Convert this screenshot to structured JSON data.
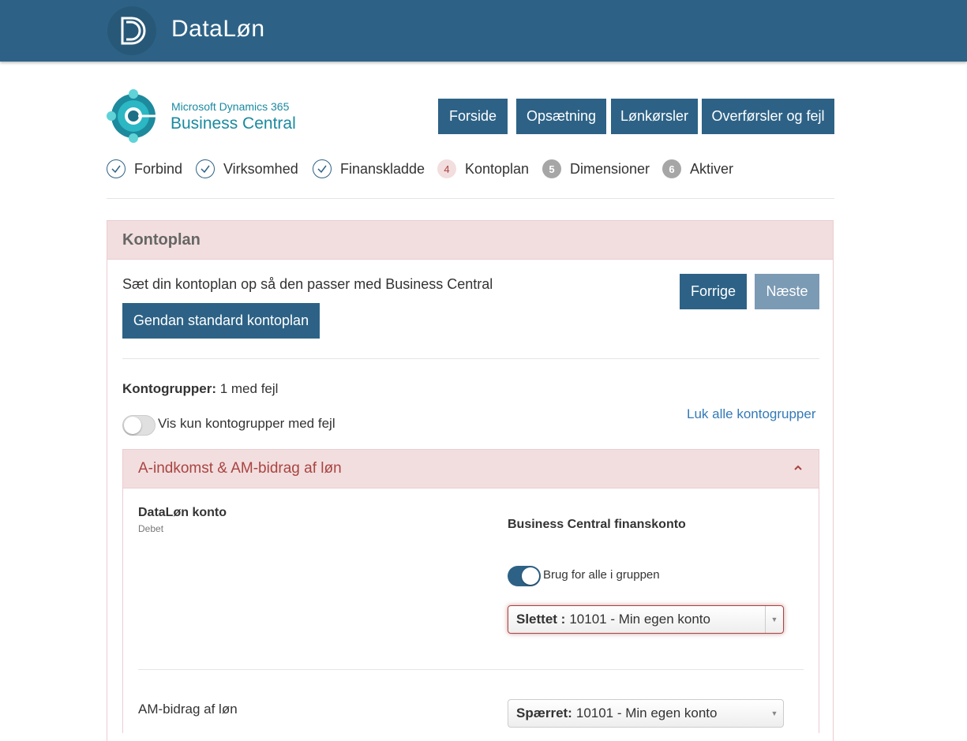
{
  "header": {
    "app_title": "DataLøn",
    "logo_icon": "dataloen-logo-icon"
  },
  "brand": {
    "line1": "Microsoft Dynamics 365",
    "line2": "Business Central",
    "logo_icon": "business-central-logo-icon"
  },
  "nav": {
    "forside": "Forside",
    "opsaetning": "Opsætning",
    "loenkoersler": "Lønkørsler",
    "overfoersler": "Overførsler og fejl"
  },
  "steps": [
    {
      "label": "Forbind",
      "state": "done"
    },
    {
      "label": "Virksomhed",
      "state": "done"
    },
    {
      "label": "Finanskladde",
      "state": "done"
    },
    {
      "num": "4",
      "label": "Kontoplan",
      "state": "active"
    },
    {
      "num": "5",
      "label": "Dimensioner",
      "state": "todo"
    },
    {
      "num": "6",
      "label": "Aktiver",
      "state": "todo"
    }
  ],
  "panel": {
    "title": "Kontoplan",
    "description": "Sæt din kontoplan op så den passer med Business Central",
    "restore_button": "Gendan standard kontoplan",
    "prev_button": "Forrige",
    "next_button": "Næste",
    "groups_label": "Kontogrupper:",
    "groups_value": "1 med fejl",
    "toggle_label": "Vis kun kontogrupper med fejl",
    "toggle_on": false,
    "close_all_link": "Luk alle kontogrupper"
  },
  "group": {
    "title": "A-indkomst & AM-bidrag af løn",
    "col_left_title": "DataLøn konto",
    "col_left_sub": "Debet",
    "col_right_title": "Business Central finanskonto",
    "use_all_label": "Brug for alle i gruppen",
    "use_all_on": true,
    "select1_prefix": "Slettet :",
    "select1_value": "10101 - Min egen konto",
    "row2_label": "AM-bidrag af løn",
    "select2_prefix": "Spærret:",
    "select2_value": "10101 - Min egen konto"
  },
  "colors": {
    "primary": "#2d6286",
    "danger_bg": "#f2dede",
    "danger_text": "#a94442",
    "link": "#337ab7"
  }
}
